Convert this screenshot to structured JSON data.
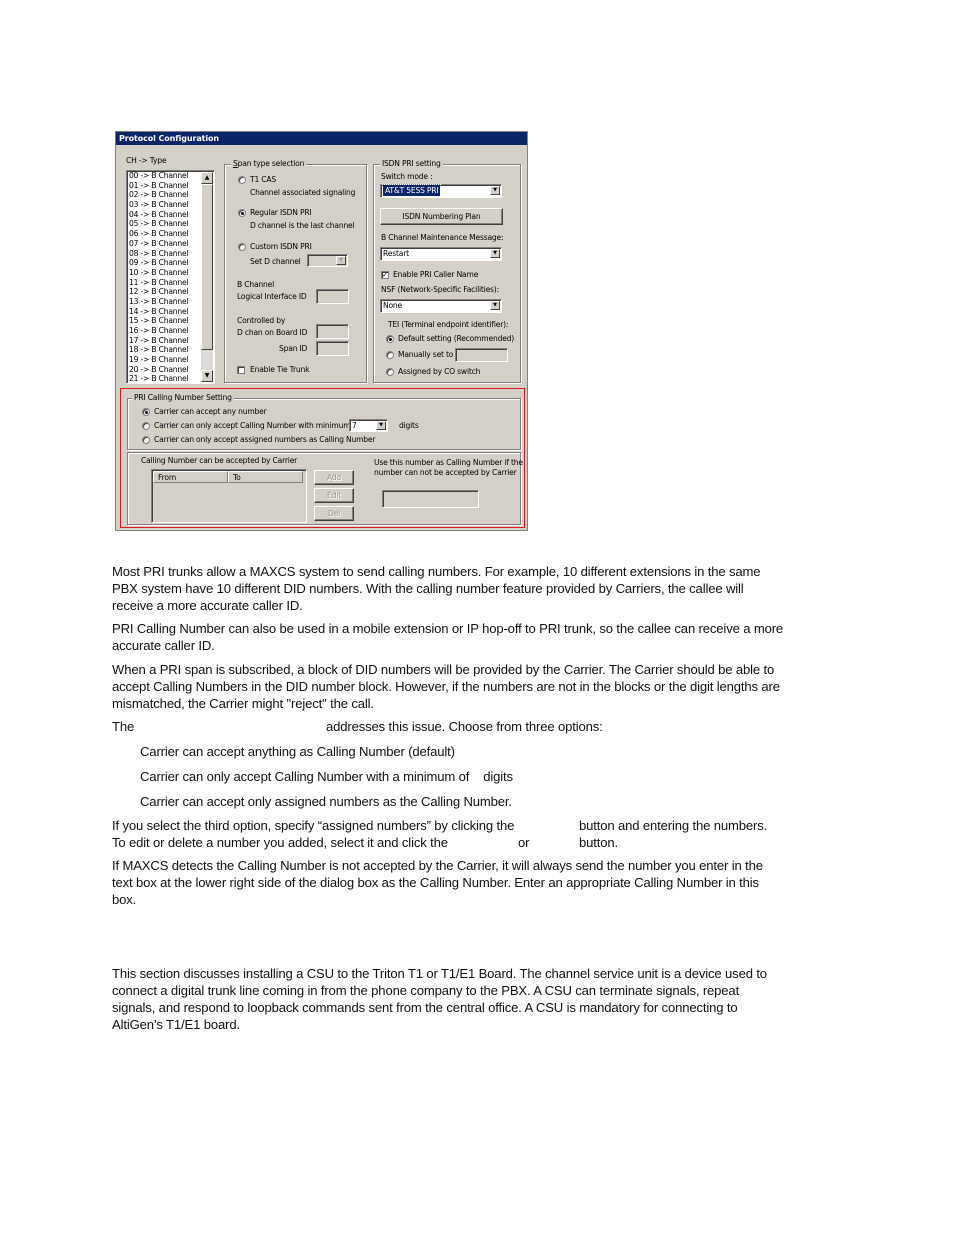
{
  "dialog": {
    "title": "Protocol Configuration",
    "channel_list": {
      "header": "CH   -> Type",
      "items": [
        "00 -> B Channel",
        "01 -> B Channel",
        "02 -> B Channel",
        "03 -> B Channel",
        "04 -> B Channel",
        "05 -> B Channel",
        "06 -> B Channel",
        "07 -> B Channel",
        "08 -> B Channel",
        "09 -> B Channel",
        "10 -> B Channel",
        "11 -> B Channel",
        "12 -> B Channel",
        "13 -> B Channel",
        "14 -> B Channel",
        "15 -> B Channel",
        "16 -> B Channel",
        "17 -> B Channel",
        "18 -> B Channel",
        "19 -> B Channel",
        "20 -> B Channel",
        "21 -> B Channel"
      ]
    },
    "span_type": {
      "legend": "Span type selection",
      "t1_cas": {
        "label": "T1 CAS",
        "desc": "Channel associated signaling",
        "selected": false
      },
      "regular_isdn": {
        "label": "Regular ISDN PRI",
        "desc": "D channel is the last channel",
        "selected": true
      },
      "custom_isdn": {
        "label": "Custom ISDN PRI",
        "selected": false
      },
      "set_d_channel_label": "Set D channel",
      "set_d_channel_value": "",
      "b_channel_label": "B Channel",
      "logical_interface_label": "Logical Interface ID",
      "logical_interface_value": "",
      "controlled_by_label": "Controlled by",
      "d_chan_board_label": "D chan on Board ID",
      "d_chan_board_value": "",
      "span_id_label": "Span ID",
      "span_id_value": "",
      "enable_tie_trunk_label": "Enable Tie Trunk",
      "enable_tie_trunk_checked": false
    },
    "isdn_pri": {
      "legend": "ISDN PRI setting",
      "switch_mode_label": "Switch mode :",
      "switch_mode_value": "AT&T 5ESS PRI",
      "numbering_plan_button": "ISDN Numbering Plan",
      "b_channel_maint_label": "B Channel Maintenance Message:",
      "b_channel_maint_value": "Restart",
      "enable_caller_name_label": "Enable PRI Caller Name",
      "enable_caller_name_checked": true,
      "nsf_label": "NSF (Network-Specific Facilities):",
      "nsf_value": "None",
      "tei_label": "TEI (Terminal endpoint identifier):",
      "tei_default_label": "Default setting (Recommended)",
      "tei_manual_label": "Manually set to",
      "tei_manual_value": "",
      "tei_assigned_label": "Assigned by CO switch",
      "tei_selected": "default"
    },
    "calling_number": {
      "legend": "PRI Calling Number Setting",
      "opt_any": "Carrier can accept any number",
      "opt_minimum": "Carrier can only accept Calling Number with minimum",
      "minimum_digits_value": "7",
      "digits_label": "digits",
      "opt_assigned": "Carrier can only accept assigned numbers as Calling Number",
      "selected": "any",
      "accepted_label": "Calling Number can be accepted by Carrier",
      "columns": [
        "From",
        "To"
      ],
      "rows": [],
      "add_button": "Add",
      "edit_button": "Edit",
      "del_button": "Del",
      "fallback_label_1": "Use this number as Calling Number if the",
      "fallback_label_2": "number can not be accepted by Carrier",
      "fallback_value": ""
    }
  },
  "body": {
    "para1": "Most PRI trunks allow a MAXCS system to send calling numbers. For example, 10 different extensions in the same PBX system have 10 different DID numbers. With the calling number feature provided by Carriers, the callee will receive a more accurate caller ID.",
    "para2": "PRI Calling Number can also be used in a mobile extension or IP hop-off to PRI trunk, so the callee can receive a more accurate caller ID.",
    "para3": "When a PRI span is subscribed, a block of DID numbers will be provided by the Carrier. The Carrier should be able to accept Calling Numbers in the DID number block. However, if the numbers are not in the blocks or the digit lengths are mismatched, the Carrier might \"reject\" the call.",
    "para4_start": "The",
    "para4_end": "addresses this issue. Choose from three options:",
    "option1": "Carrier can accept anything as Calling Number (default)",
    "option2": "Carrier can only accept Calling Number with a minimum of    digits",
    "option3": "Carrier can accept only assigned numbers as the Calling Number.",
    "para5_line1_a": "If you select the third option, specify “assigned numbers” by clicking the",
    "para5_line1_b": "button and entering the numbers.",
    "para5_line2_a": "To edit or delete a number you added, select it and click the",
    "para5_line2_b": "or",
    "para5_line2_c": "button.",
    "para6": "If MAXCS detects the Calling Number is not accepted by the Carrier, it will always send the number you enter in the text box at the lower right side of the dialog box as the Calling Number. Enter an appropriate Calling Number in this box.",
    "para7": "This section discusses installing a CSU to the Triton T1 or T1/E1 Board. The channel service unit is a device used to connect a digital trunk line coming in from the phone company to the PBX. A CSU can terminate signals, repeat signals, and respond to loopback commands sent from the central office. A CSU is mandatory for connecting to AltiGen’s T1/E1 board."
  }
}
